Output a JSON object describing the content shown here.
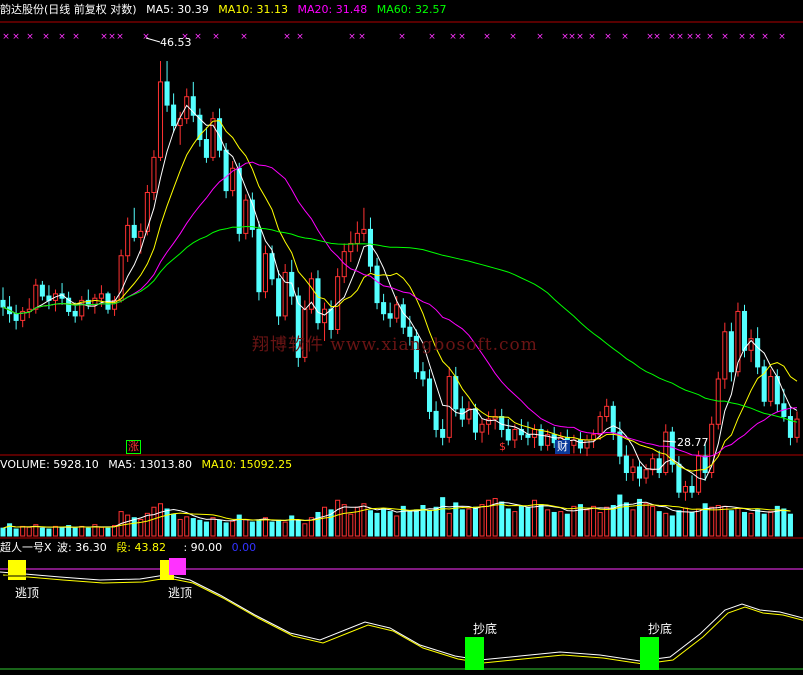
{
  "header": {
    "title": "韵达股份(日线 前复权 对数)",
    "ma5": "MA5: 30.39",
    "ma10": "MA10: 31.13",
    "ma20": "MA20: 31.48",
    "ma60": "MA60: 32.57"
  },
  "price_labels": {
    "high": "46.53",
    "low": "28.77"
  },
  "watermark": "翔博软件 www.xiangbosoft.com",
  "markers": {
    "zhang": "涨",
    "dollar": "$",
    "cai": "财"
  },
  "volume_header": {
    "volume": "VOLUME: 5928.10",
    "ma5": "MA5: 13013.80",
    "ma10": "MA10: 15092.25"
  },
  "indicator_header": {
    "name": "超人一号X",
    "bo": "波: 36.30",
    "duan": "段: 43.82",
    "level": ": 90.00",
    "zero": "0.00"
  },
  "signals": {
    "escape": "逃顶",
    "bottom": "抄底"
  },
  "colors": {
    "ma5": "#ffffff",
    "ma10": "#ffff00",
    "ma20": "#ff00ff",
    "ma60": "#00ff00",
    "up": "#ff3232",
    "down": "#54ffff",
    "separator": "#b00000"
  },
  "chart_data": {
    "type": "candlestick",
    "scale": "log",
    "ylim": [
      27.5,
      48.5
    ],
    "candles": [
      [
        33.6,
        34.2,
        32.9,
        33.3
      ],
      [
        33.3,
        33.8,
        32.6,
        33.0
      ],
      [
        33.0,
        33.4,
        32.3,
        32.7
      ],
      [
        32.7,
        33.3,
        32.4,
        33.1
      ],
      [
        33.1,
        33.7,
        32.8,
        33.2
      ],
      [
        33.2,
        34.6,
        33.0,
        34.3
      ],
      [
        34.3,
        34.5,
        33.6,
        33.8
      ],
      [
        33.8,
        34.3,
        33.2,
        33.6
      ],
      [
        33.6,
        34.1,
        33.1,
        33.9
      ],
      [
        33.9,
        34.4,
        33.4,
        33.7
      ],
      [
        33.7,
        34.0,
        32.9,
        33.1
      ],
      [
        33.1,
        33.5,
        32.6,
        32.9
      ],
      [
        32.9,
        33.8,
        32.7,
        33.6
      ],
      [
        33.6,
        34.1,
        33.2,
        33.4
      ],
      [
        33.4,
        33.9,
        33.0,
        33.7
      ],
      [
        33.7,
        34.3,
        33.3,
        33.9
      ],
      [
        33.9,
        34.0,
        33.0,
        33.2
      ],
      [
        33.2,
        33.8,
        32.9,
        33.6
      ],
      [
        33.6,
        36.0,
        33.5,
        35.7
      ],
      [
        35.7,
        37.6,
        35.4,
        37.2
      ],
      [
        37.2,
        38.1,
        36.4,
        36.6
      ],
      [
        36.6,
        37.3,
        35.8,
        36.9
      ],
      [
        36.9,
        39.3,
        36.7,
        38.9
      ],
      [
        38.9,
        41.2,
        38.5,
        40.8
      ],
      [
        40.8,
        46.5,
        40.6,
        45.2
      ],
      [
        45.2,
        46.5,
        43.4,
        43.8
      ],
      [
        43.8,
        44.5,
        42.2,
        42.6
      ],
      [
        42.6,
        43.4,
        41.5,
        43.0
      ],
      [
        43.0,
        44.8,
        42.7,
        44.3
      ],
      [
        44.3,
        45.2,
        42.8,
        43.2
      ],
      [
        43.2,
        43.6,
        41.4,
        41.8
      ],
      [
        41.8,
        42.5,
        40.5,
        40.8
      ],
      [
        40.8,
        43.4,
        40.6,
        43.0
      ],
      [
        43.0,
        43.6,
        40.8,
        41.2
      ],
      [
        41.2,
        41.6,
        38.6,
        39.0
      ],
      [
        39.0,
        40.6,
        38.7,
        40.2
      ],
      [
        40.2,
        40.5,
        36.4,
        36.8
      ],
      [
        36.8,
        38.8,
        36.5,
        38.5
      ],
      [
        38.5,
        38.9,
        36.6,
        37.0
      ],
      [
        37.0,
        37.4,
        33.6,
        34.0
      ],
      [
        34.0,
        36.2,
        33.7,
        35.8
      ],
      [
        35.8,
        36.2,
        34.3,
        34.6
      ],
      [
        34.6,
        35.0,
        32.5,
        32.9
      ],
      [
        32.9,
        35.3,
        32.7,
        34.9
      ],
      [
        34.9,
        35.5,
        33.4,
        33.8
      ],
      [
        33.8,
        34.2,
        30.7,
        31.1
      ],
      [
        31.1,
        33.6,
        30.9,
        33.2
      ],
      [
        33.2,
        34.9,
        33.0,
        34.6
      ],
      [
        34.6,
        35.0,
        32.3,
        32.6
      ],
      [
        32.6,
        33.5,
        31.8,
        33.2
      ],
      [
        33.2,
        33.6,
        31.9,
        32.3
      ],
      [
        32.3,
        35.1,
        32.1,
        34.7
      ],
      [
        34.7,
        36.3,
        34.4,
        35.9
      ],
      [
        35.9,
        36.9,
        35.4,
        36.3
      ],
      [
        36.3,
        37.4,
        35.9,
        36.8
      ],
      [
        36.8,
        38.1,
        36.4,
        37.0
      ],
      [
        37.0,
        37.6,
        34.9,
        35.2
      ],
      [
        35.2,
        35.6,
        33.2,
        33.5
      ],
      [
        33.5,
        33.9,
        32.7,
        33.0
      ],
      [
        33.0,
        33.5,
        32.4,
        32.8
      ],
      [
        32.8,
        33.8,
        32.6,
        33.4
      ],
      [
        33.4,
        33.7,
        32.1,
        32.4
      ],
      [
        32.4,
        32.9,
        31.6,
        32.0
      ],
      [
        32.0,
        32.3,
        30.2,
        30.5
      ],
      [
        30.5,
        30.9,
        29.9,
        30.2
      ],
      [
        30.2,
        30.6,
        28.6,
        28.9
      ],
      [
        28.9,
        29.3,
        27.9,
        28.2
      ],
      [
        28.2,
        28.6,
        27.6,
        27.9
      ],
      [
        27.9,
        30.7,
        27.7,
        30.3
      ],
      [
        30.3,
        30.7,
        28.7,
        29.0
      ],
      [
        29.0,
        29.5,
        28.3,
        28.6
      ],
      [
        28.6,
        29.3,
        28.4,
        29.0
      ],
      [
        29.0,
        29.2,
        27.8,
        28.1
      ],
      [
        28.1,
        28.6,
        27.7,
        28.4
      ],
      [
        28.4,
        28.9,
        28.0,
        28.6
      ],
      [
        28.6,
        29.0,
        28.2,
        28.7
      ],
      [
        28.7,
        29.0,
        27.9,
        28.2
      ],
      [
        28.2,
        28.6,
        27.6,
        27.8
      ],
      [
        27.8,
        28.4,
        27.5,
        28.2
      ],
      [
        28.2,
        28.6,
        27.8,
        28.0
      ],
      [
        28.0,
        28.5,
        27.6,
        27.9
      ],
      [
        27.9,
        28.4,
        27.5,
        28.2
      ],
      [
        28.2,
        28.4,
        27.4,
        27.6
      ],
      [
        27.6,
        28.2,
        27.4,
        28.0
      ],
      [
        28.0,
        28.3,
        27.5,
        27.7
      ],
      [
        27.7,
        28.1,
        27.3,
        27.9
      ],
      [
        27.9,
        28.2,
        27.4,
        27.6
      ],
      [
        27.6,
        28.0,
        27.3,
        27.8
      ],
      [
        27.8,
        28.1,
        27.3,
        27.5
      ],
      [
        27.5,
        28.0,
        27.2,
        27.8
      ],
      [
        27.8,
        28.2,
        27.5,
        28.0
      ],
      [
        28.0,
        28.9,
        27.8,
        28.7
      ],
      [
        28.7,
        29.4,
        28.5,
        29.1
      ],
      [
        29.1,
        29.3,
        27.8,
        28.1
      ],
      [
        28.1,
        28.5,
        26.9,
        27.2
      ],
      [
        27.2,
        27.6,
        26.3,
        26.6
      ],
      [
        26.6,
        27.1,
        26.3,
        26.8
      ],
      [
        26.8,
        27.0,
        26.1,
        26.4
      ],
      [
        26.4,
        26.9,
        26.2,
        26.7
      ],
      [
        26.7,
        27.3,
        26.5,
        27.1
      ],
      [
        27.1,
        27.4,
        26.4,
        26.6
      ],
      [
        26.6,
        28.4,
        26.5,
        28.1
      ],
      [
        28.1,
        28.3,
        26.6,
        26.9
      ],
      [
        26.9,
        27.2,
        25.7,
        25.9
      ],
      [
        25.9,
        26.3,
        25.6,
        26.1
      ],
      [
        26.1,
        26.5,
        25.7,
        25.9
      ],
      [
        25.9,
        27.4,
        25.8,
        27.2
      ],
      [
        27.2,
        27.7,
        26.3,
        26.6
      ],
      [
        26.6,
        28.7,
        26.4,
        28.4
      ],
      [
        28.4,
        30.5,
        28.2,
        30.2
      ],
      [
        30.2,
        32.6,
        29.8,
        32.2
      ],
      [
        32.2,
        32.6,
        30.1,
        30.5
      ],
      [
        30.5,
        33.5,
        30.3,
        33.1
      ],
      [
        33.1,
        33.4,
        31.1,
        31.4
      ],
      [
        31.4,
        32.3,
        30.9,
        31.9
      ],
      [
        31.9,
        32.4,
        30.4,
        30.7
      ],
      [
        30.7,
        31.0,
        29.1,
        29.3
      ],
      [
        29.3,
        30.6,
        29.1,
        30.3
      ],
      [
        30.3,
        30.6,
        28.9,
        29.2
      ],
      [
        29.2,
        29.8,
        28.5,
        28.7
      ],
      [
        28.7,
        29.1,
        27.6,
        27.9
      ],
      [
        27.9,
        28.9,
        27.7,
        28.6
      ]
    ],
    "volume_ylim": [
      0,
      70000
    ],
    "volume": [
      9000,
      14000,
      8000,
      11000,
      10000,
      13000,
      9000,
      8000,
      11000,
      10000,
      12000,
      9000,
      11000,
      9000,
      13000,
      10000,
      9000,
      12000,
      28000,
      24000,
      21000,
      19000,
      26000,
      33000,
      37000,
      31000,
      25000,
      19000,
      22000,
      20000,
      18000,
      16000,
      21000,
      18000,
      15000,
      17000,
      24000,
      19000,
      16000,
      18000,
      21000,
      16000,
      18000,
      16000,
      23000,
      18000,
      14000,
      21000,
      27000,
      33000,
      30000,
      41000,
      36000,
      25000,
      33000,
      37000,
      29000,
      26000,
      31000,
      28000,
      23000,
      34000,
      28000,
      30000,
      35000,
      29000,
      33000,
      44000,
      26000,
      38000,
      30000,
      31000,
      33000,
      36000,
      41000,
      43000,
      39000,
      31000,
      28000,
      34000,
      33000,
      41000,
      36000,
      30000,
      27000,
      28000,
      25000,
      34000,
      36000,
      30000,
      34000,
      27000,
      33000,
      35000,
      47000,
      38000,
      30000,
      42000,
      37000,
      34000,
      28000,
      26000,
      23000,
      29000,
      32000,
      27000,
      31000,
      37000,
      33000,
      35000,
      34000,
      29000,
      32000,
      27000,
      26000,
      30000,
      25000,
      28000,
      34000,
      31000,
      25000
    ],
    "indicator": {
      "level": 90.0,
      "bo": 36.3,
      "duan": 43.82
    }
  }
}
